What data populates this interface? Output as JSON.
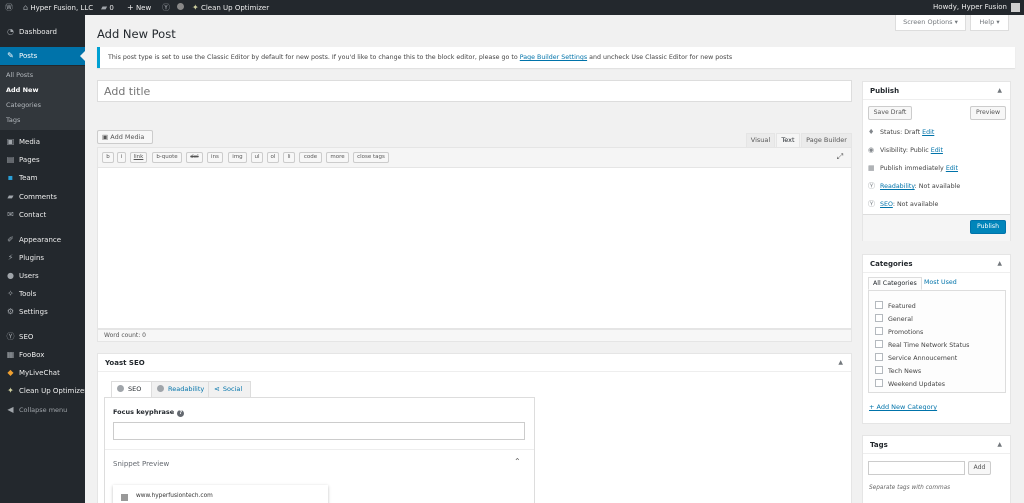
{
  "admin_bar": {
    "site_name": "Hyper Fusion, LLC",
    "comments_count": "0",
    "new_label": "New",
    "cleanup_label": "Clean Up Optimizer",
    "howdy": "Howdy, Hyper Fusion",
    "icons": [
      "wordpress-logo-icon",
      "home-icon",
      "comment-bubble-icon",
      "plus-icon",
      "yoast-icon",
      "status-dot-icon",
      "cleanup-icon"
    ]
  },
  "sidebar": {
    "items": [
      {
        "label": "Dashboard",
        "icon": "dashboard-icon"
      },
      {
        "label": "Posts",
        "icon": "pin-icon"
      },
      {
        "label": "Media",
        "icon": "media-icon"
      },
      {
        "label": "Pages",
        "icon": "pages-icon"
      },
      {
        "label": "Team",
        "icon": "team-icon"
      },
      {
        "label": "Comments",
        "icon": "comments-icon"
      },
      {
        "label": "Contact",
        "icon": "mail-icon"
      },
      {
        "label": "Appearance",
        "icon": "brush-icon"
      },
      {
        "label": "Plugins",
        "icon": "plugin-icon"
      },
      {
        "label": "Users",
        "icon": "users-icon"
      },
      {
        "label": "Tools",
        "icon": "tools-icon"
      },
      {
        "label": "Settings",
        "icon": "settings-icon"
      },
      {
        "label": "SEO",
        "icon": "yoast-icon"
      },
      {
        "label": "FooBox",
        "icon": "foobox-icon"
      },
      {
        "label": "MyLiveChat",
        "icon": "chat-icon"
      },
      {
        "label": "Clean Up Optimizer",
        "icon": "cleanup-icon"
      },
      {
        "label": "Collapse menu",
        "icon": "collapse-icon"
      }
    ],
    "submenu": [
      "All Posts",
      "Add New",
      "Categories",
      "Tags"
    ]
  },
  "screen_options": "Screen Options",
  "help": "Help",
  "page_title": "Add New Post",
  "notice": {
    "before": "This post type is set to use the Classic Editor by default for new posts. If you'd like to change this to the block editor, please go to",
    "link": "Page Builder Settings",
    "after": "and uncheck Use Classic Editor for new posts"
  },
  "title_placeholder": "Add title",
  "editor": {
    "add_media": "Add Media",
    "tabs": [
      "Visual",
      "Text",
      "Page Builder"
    ],
    "active_tab": "Text",
    "quicktags": [
      "b",
      "i",
      "link",
      "b-quote",
      "del",
      "ins",
      "img",
      "ul",
      "ol",
      "li",
      "code",
      "more",
      "close tags"
    ],
    "word_count": "Word count: 0"
  },
  "yoast": {
    "title": "Yoast SEO",
    "tabs": [
      "SEO",
      "Readability",
      "Social"
    ],
    "focus_label": "Focus keyphrase",
    "snippet_label": "Snippet Preview",
    "snippet_url": "www.hyperfusiontech.com"
  },
  "publish": {
    "title": "Publish",
    "save_draft": "Save Draft",
    "preview": "Preview",
    "status_label": "Status:",
    "status_value": "Draft",
    "visibility_label": "Visibility:",
    "visibility_value": "Public",
    "publish_label": "Publish",
    "publish_value": "immediately",
    "readability_link": "Readability",
    "readability_value": ": Not available",
    "seo_link": "SEO",
    "seo_value": ": Not available",
    "edit": "Edit",
    "publish_button": "Publish"
  },
  "categories": {
    "title": "Categories",
    "tab_all": "All Categories",
    "tab_used": "Most Used",
    "items": [
      "Featured",
      "General",
      "Promotions",
      "Real Time Network Status",
      "Service Annoucement",
      "Tech News",
      "Weekend Updates"
    ],
    "add_link": "+ Add New Category"
  },
  "tags": {
    "title": "Tags",
    "add": "Add",
    "hint": "Separate tags with commas"
  },
  "colors": {
    "admin_bar": "#23282d",
    "accent": "#0073aa",
    "primary_button": "#0085ba",
    "notice_border": "#00a0d2"
  }
}
